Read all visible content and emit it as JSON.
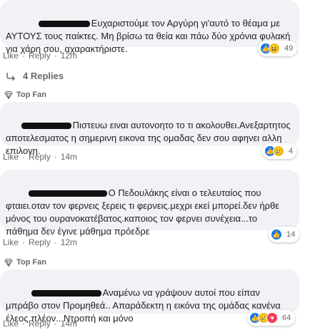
{
  "comments": [
    {
      "text": "Ευχαριστούμε τον Αργύρη γι'αυτό το θέαμα με ΑΥΤΟΥΣ τους παίκτες. Μη βρίσω τα θεία και πάω δύο χρόνια φυλακή για χάρη σου, αχαρακτήριστε.",
      "like": "Like",
      "reply": "Reply",
      "time": "12m",
      "reaction_count": "49"
    },
    {
      "badge": "Top Fan",
      "text": "Πιστευω ειναι αυτονοητο το τι ακολουθει.Ανεξαρτητος αποτελεσματος η σημερινη εικονα της ομαδας δεν σου αφηνει αλλη επιλογη.",
      "like": "Like",
      "reply": "Reply",
      "time": "14m",
      "reaction_count": "4"
    },
    {
      "text": "Ο Πεδουλάκης είναι ο τελευταίος που φταιει.οταν τον φερνεις ξερεις τι φερνεις.μεχρι εκεί μπορεί.δεν ήρθε μόνος του ουρανοκατέβατος.καποιος τον φερνει συνέχεια...το πάθημα δεν έγινε μάθημα πρόεδρε",
      "like": "Like",
      "reply": "Reply",
      "time": "12m",
      "reaction_count": "14"
    },
    {
      "badge": "Top Fan",
      "text": "Αναμένω να γράψουν αυτοί που είπαν μπράβο στον Προμηθεά.. Απαράδεκτη η εικόνα της ομάδας κανένα έλεος πλέον.. Ντροπή και μόνο",
      "like": "Like",
      "reply": "Reply",
      "time": "14m",
      "reaction_count": "64"
    }
  ],
  "replies_label": "4 Replies",
  "separator": "·",
  "colors": {
    "like": "#1877f2",
    "haha": "#f7b928",
    "love": "#f33e58",
    "bubble": "#f0f2f5"
  }
}
